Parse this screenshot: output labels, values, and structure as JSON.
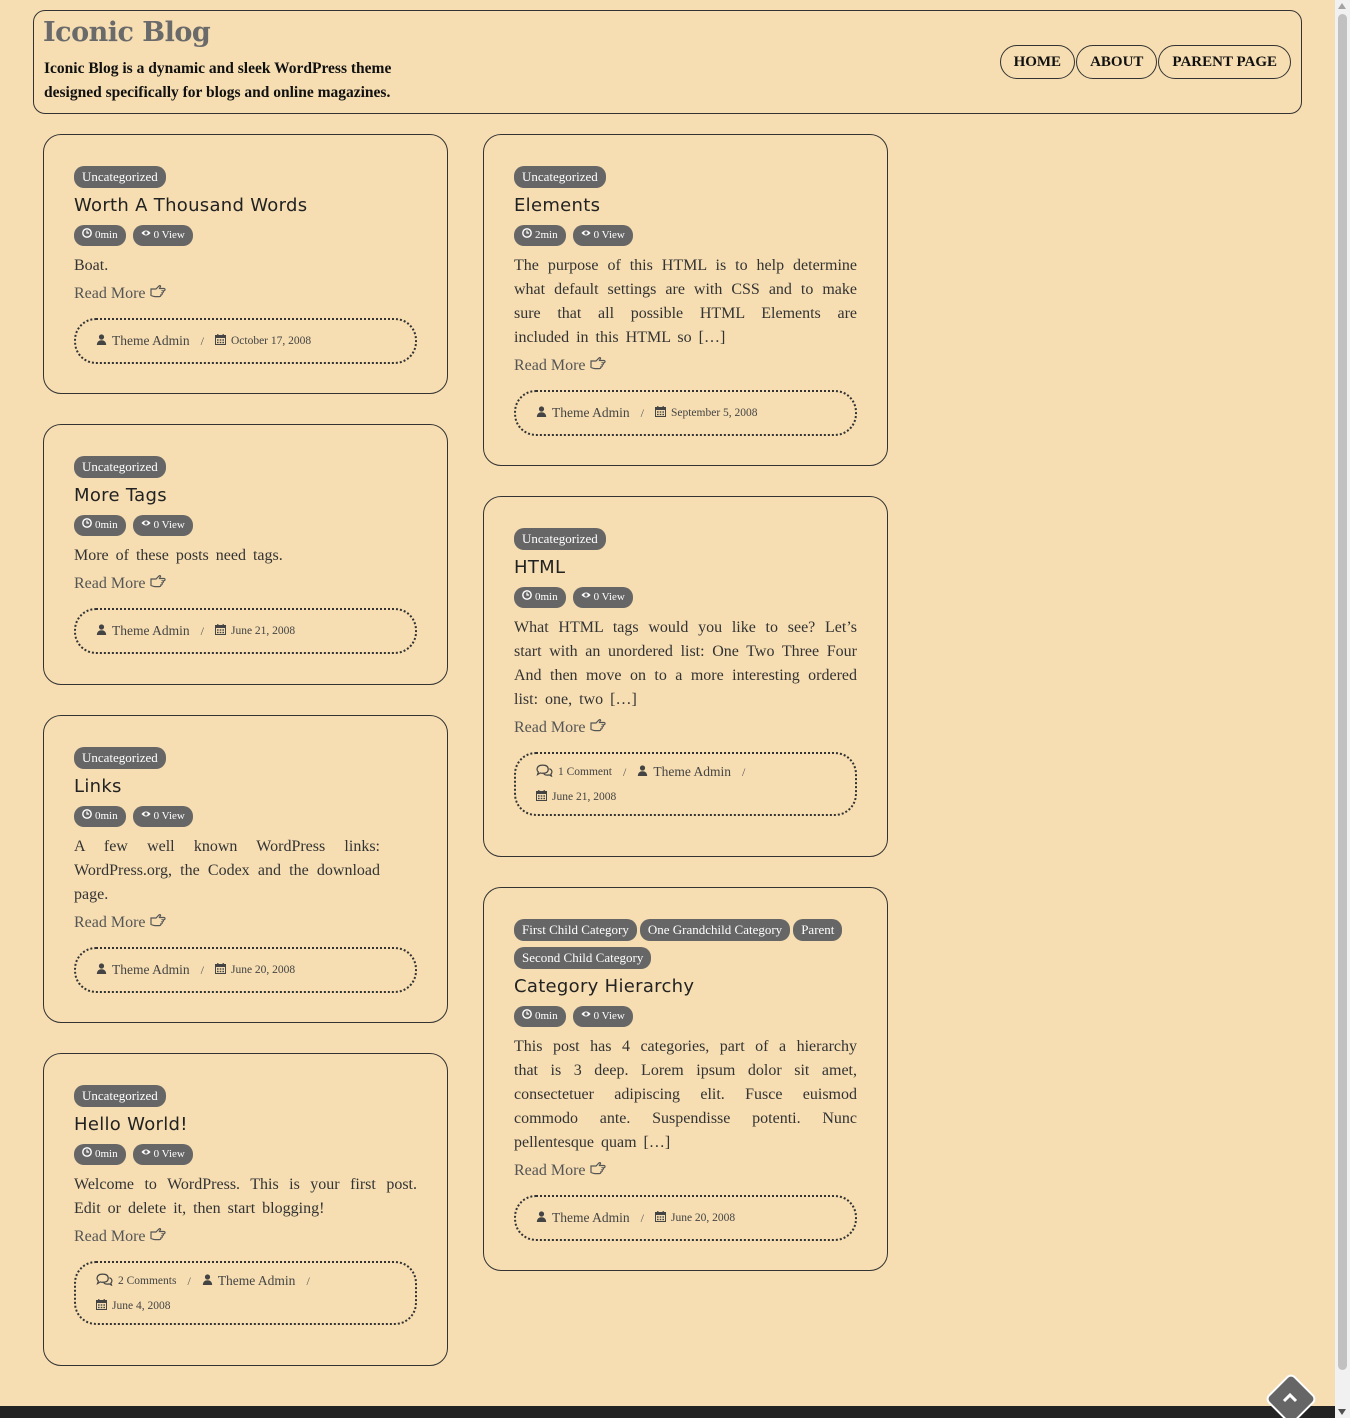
{
  "header": {
    "title": "Iconic Blog",
    "description": "Iconic Blog is a dynamic and sleek WordPress theme designed specifically for blogs and online magazines.",
    "nav": [
      "HOME",
      "ABOUT",
      "PARENT PAGE"
    ]
  },
  "posts": [
    {
      "categories": [
        "Uncategorized"
      ],
      "title": "Worth A Thousand Words",
      "read_time": "0min",
      "views": "0 View",
      "excerpt": "Boat.",
      "read_more": "Read More",
      "comments": "",
      "author": "Theme Admin",
      "date": "October 17, 2008"
    },
    {
      "categories": [
        "Uncategorized"
      ],
      "title": "More Tags",
      "read_time": "0min",
      "views": "0 View",
      "excerpt": "More of these posts need tags.",
      "read_more": "Read More",
      "comments": "",
      "author": "Theme Admin",
      "date": "June 21, 2008"
    },
    {
      "categories": [
        "Uncategorized"
      ],
      "title": "Links",
      "read_time": "0min",
      "views": "0 View",
      "excerpt": "A few well known WordPress links: WordPress.org, the Codex and the download page.",
      "read_more": "Read More",
      "comments": "",
      "author": "Theme Admin",
      "date": "June 20, 2008"
    },
    {
      "categories": [
        "Uncategorized"
      ],
      "title": "Hello World!",
      "read_time": "0min",
      "views": "0 View",
      "excerpt": "Welcome to WordPress. This is your first post. Edit or delete it, then start blogging!",
      "read_more": "Read More",
      "comments": "2 Comments",
      "author": "Theme Admin",
      "date": "June 4, 2008"
    },
    {
      "categories": [
        "Uncategorized"
      ],
      "title": "Elements",
      "read_time": "2min",
      "views": "0 View",
      "excerpt": "The purpose of this HTML is to help determine what default settings are with CSS and to make sure that all possible HTML Elements are included in this HTML so […]",
      "read_more": "Read More",
      "comments": "",
      "author": "Theme Admin",
      "date": "September 5, 2008"
    },
    {
      "categories": [
        "Uncategorized"
      ],
      "title": "HTML",
      "read_time": "0min",
      "views": "0 View",
      "excerpt": "What HTML tags would you like to see? Let’s start with an unordered list: One Two Three Four And then move on to a more interesting ordered list: one, two […]",
      "read_more": "Read More",
      "comments": "1 Comment",
      "author": "Theme Admin",
      "date": "June 21, 2008"
    },
    {
      "categories": [
        "First Child Category",
        "One Grandchild Category",
        "Parent",
        "Second Child Category"
      ],
      "title": "Category Hierarchy",
      "read_time": "0min",
      "views": "0 View",
      "excerpt": "This post has 4 categories, part of a hierarchy that is 3 deep. Lorem ipsum dolor sit amet, consectetuer adipiscing elit. Fusce euismod commodo ante. Suspendisse potenti. Nunc pellentesque quam […]",
      "read_more": "Read More",
      "comments": "",
      "author": "Theme Admin",
      "date": "June 20, 2008"
    }
  ]
}
